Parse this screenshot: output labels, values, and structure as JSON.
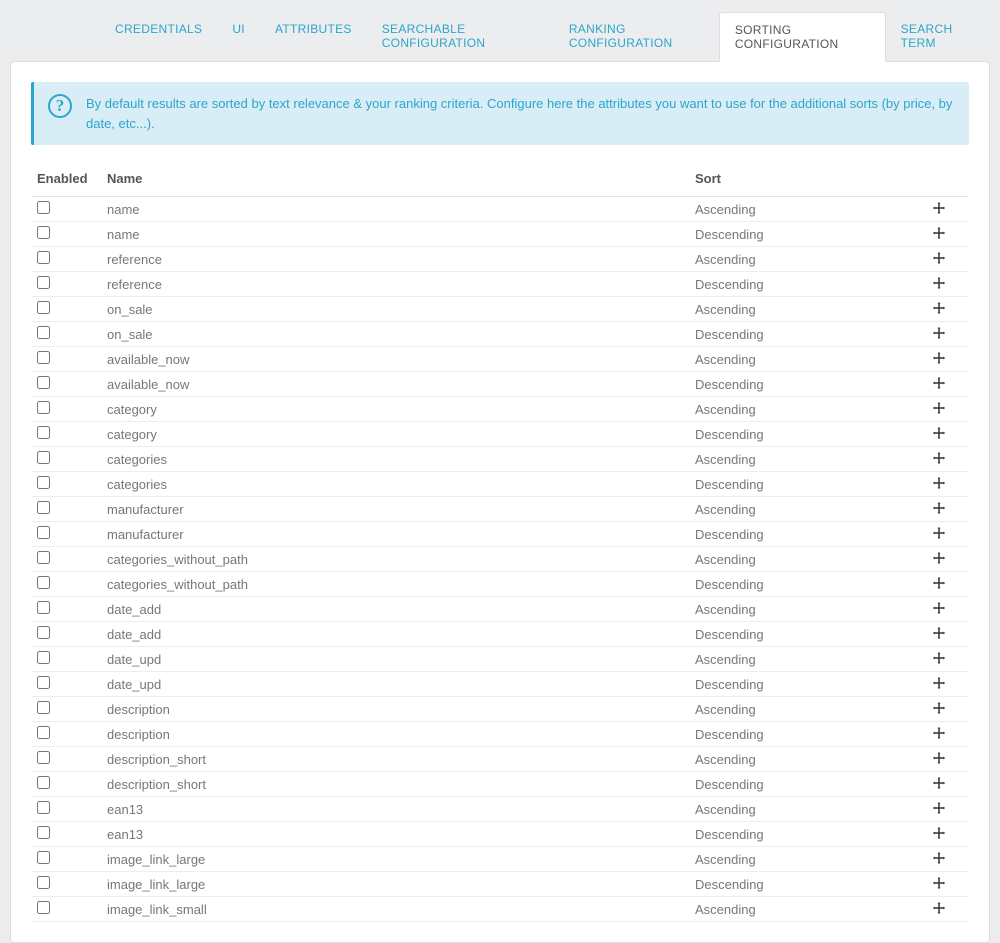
{
  "tabs": [
    {
      "label": "CREDENTIALS",
      "active": false
    },
    {
      "label": "UI",
      "active": false
    },
    {
      "label": "ATTRIBUTES",
      "active": false
    },
    {
      "label": "SEARCHABLE CONFIGURATION",
      "active": false
    },
    {
      "label": "RANKING CONFIGURATION",
      "active": false
    },
    {
      "label": "SORTING CONFIGURATION",
      "active": true
    },
    {
      "label": "SEARCH TERM",
      "active": false
    }
  ],
  "alert": {
    "icon": "?",
    "text": "By default results are sorted by text relevance & your ranking criteria. Configure here the attributes you want to use for the additional sorts (by price, by date, etc...)."
  },
  "table": {
    "headers": {
      "enabled": "Enabled",
      "name": "Name",
      "sort": "Sort"
    },
    "rows": [
      {
        "enabled": false,
        "name": "name",
        "sort": "Ascending"
      },
      {
        "enabled": false,
        "name": "name",
        "sort": "Descending"
      },
      {
        "enabled": false,
        "name": "reference",
        "sort": "Ascending"
      },
      {
        "enabled": false,
        "name": "reference",
        "sort": "Descending"
      },
      {
        "enabled": false,
        "name": "on_sale",
        "sort": "Ascending"
      },
      {
        "enabled": false,
        "name": "on_sale",
        "sort": "Descending"
      },
      {
        "enabled": false,
        "name": "available_now",
        "sort": "Ascending"
      },
      {
        "enabled": false,
        "name": "available_now",
        "sort": "Descending"
      },
      {
        "enabled": false,
        "name": "category",
        "sort": "Ascending"
      },
      {
        "enabled": false,
        "name": "category",
        "sort": "Descending"
      },
      {
        "enabled": false,
        "name": "categories",
        "sort": "Ascending"
      },
      {
        "enabled": false,
        "name": "categories",
        "sort": "Descending"
      },
      {
        "enabled": false,
        "name": "manufacturer",
        "sort": "Ascending"
      },
      {
        "enabled": false,
        "name": "manufacturer",
        "sort": "Descending"
      },
      {
        "enabled": false,
        "name": "categories_without_path",
        "sort": "Ascending"
      },
      {
        "enabled": false,
        "name": "categories_without_path",
        "sort": "Descending"
      },
      {
        "enabled": false,
        "name": "date_add",
        "sort": "Ascending"
      },
      {
        "enabled": false,
        "name": "date_add",
        "sort": "Descending"
      },
      {
        "enabled": false,
        "name": "date_upd",
        "sort": "Ascending"
      },
      {
        "enabled": false,
        "name": "date_upd",
        "sort": "Descending"
      },
      {
        "enabled": false,
        "name": "description",
        "sort": "Ascending"
      },
      {
        "enabled": false,
        "name": "description",
        "sort": "Descending"
      },
      {
        "enabled": false,
        "name": "description_short",
        "sort": "Ascending"
      },
      {
        "enabled": false,
        "name": "description_short",
        "sort": "Descending"
      },
      {
        "enabled": false,
        "name": "ean13",
        "sort": "Ascending"
      },
      {
        "enabled": false,
        "name": "ean13",
        "sort": "Descending"
      },
      {
        "enabled": false,
        "name": "image_link_large",
        "sort": "Ascending"
      },
      {
        "enabled": false,
        "name": "image_link_large",
        "sort": "Descending"
      },
      {
        "enabled": false,
        "name": "image_link_small",
        "sort": "Ascending"
      }
    ]
  }
}
